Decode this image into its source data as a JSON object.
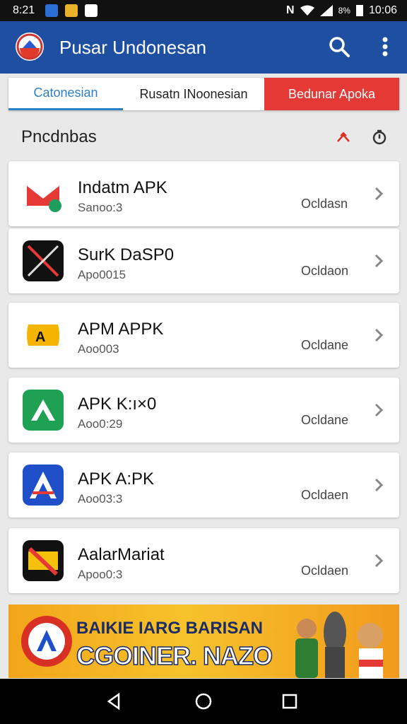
{
  "status_bar": {
    "time": "8:21",
    "battery": "8%",
    "clock": "10:06"
  },
  "app_bar": {
    "title": "Pusar Undonesan"
  },
  "tabs": [
    "Catonesian",
    "Rusatn INoonesian",
    "Bedunar Apoka"
  ],
  "section": {
    "title": "Pncdnbas"
  },
  "apps": [
    {
      "name": "Indatm APK",
      "code": "Sanoo:3",
      "status": "Ocldasn"
    },
    {
      "name": "SurK DaSP0",
      "code": "Apo0015",
      "status": "Ocldaon"
    },
    {
      "name": "APM APPK",
      "code": "Aoo003",
      "status": "Ocldane"
    },
    {
      "name": "APK K:ı×0",
      "code": "Aoo0:29",
      "status": "Ocldane"
    },
    {
      "name": "APK A:PK",
      "code": "Aoo03:3",
      "status": "Ocldaen"
    },
    {
      "name": "AalarMariat",
      "code": "Apoo0:3",
      "status": "Ocldaen"
    }
  ],
  "banner": {
    "line1": "BAIKIE IARG BARISAN",
    "line2": "CGOINER. NAZO"
  },
  "colors": {
    "app_bar": "#1f4fa0",
    "tab_active": "#2c7fc5",
    "tab_accent": "#e53935",
    "banner": "#f6c22b"
  },
  "icons": [
    "gmail-like-icon",
    "crossed-swords-icon",
    "scroll-icon",
    "green-arrow-icon",
    "blue-a-icon",
    "no-sign-icon"
  ]
}
